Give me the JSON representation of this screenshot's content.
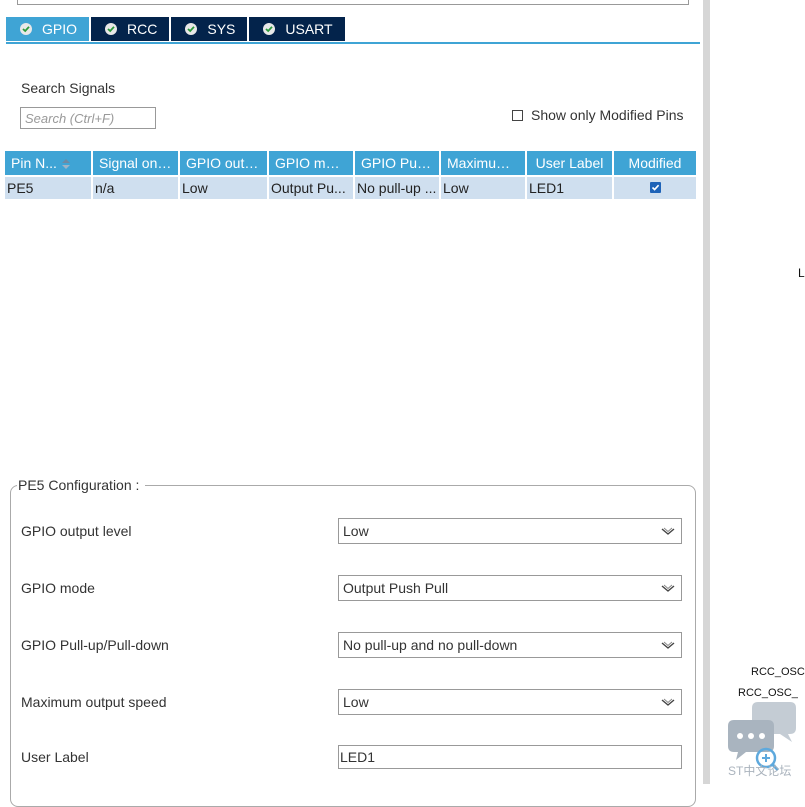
{
  "tabs": [
    {
      "label": "GPIO",
      "icon": "check-circle-icon",
      "active": true
    },
    {
      "label": "RCC",
      "icon": "check-circle-icon",
      "active": false
    },
    {
      "label": "SYS",
      "icon": "check-circle-icon",
      "active": false
    },
    {
      "label": "USART",
      "icon": "check-circle-icon",
      "active": false
    }
  ],
  "search": {
    "label": "Search Signals",
    "placeholder": "Search (Ctrl+F)",
    "only_modified_label": "Show only Modified Pins",
    "only_modified_checked": false
  },
  "table": {
    "headers": [
      "Pin N...",
      "Signal on ...",
      "GPIO outp...",
      "GPIO mode",
      "GPIO Pull-...",
      "Maximum ...",
      "User Label",
      "Modified"
    ],
    "rows": [
      {
        "pin": "PE5",
        "signal": "n/a",
        "output": "Low",
        "mode": "Output Pu...",
        "pull": "No pull-up ...",
        "speed": "Low",
        "label": "LED1",
        "modified": true
      }
    ]
  },
  "config": {
    "title": "PE5 Configuration :",
    "output_level_label": "GPIO output level",
    "output_level_value": "Low",
    "mode_label": "GPIO mode",
    "mode_value": "Output Push Pull",
    "pull_label": "GPIO Pull-up/Pull-down",
    "pull_value": "No pull-up and no pull-down",
    "speed_label": "Maximum output speed",
    "speed_value": "Low",
    "user_label_label": "User Label",
    "user_label_value": "LED1"
  },
  "right_panel": {
    "edge_letter": "L",
    "osc_label_1": "RCC_OSC",
    "osc_label_2": "RCC_OSC_",
    "watermark_text": "ST中文论坛"
  },
  "colors": {
    "accent": "#3fa4d5",
    "tab_dark": "#03234b",
    "row_bg": "#cfdfef",
    "checkbox_blue": "#1e63b8"
  }
}
